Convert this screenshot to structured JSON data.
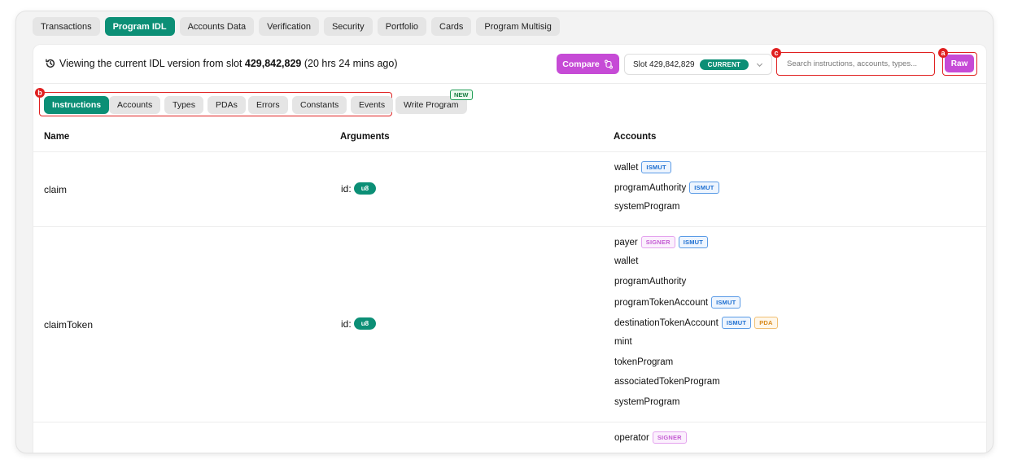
{
  "top_tabs": [
    "Transactions",
    "Program IDL",
    "Accounts Data",
    "Verification",
    "Security",
    "Portfolio",
    "Cards",
    "Program Multisig"
  ],
  "active_top_tab": "Program IDL",
  "header": {
    "viewing_prefix": "Viewing the current IDL version from slot ",
    "slot": "429,842,829",
    "viewing_suffix": " (20 hrs 24 mins ago)",
    "compare_label": "Compare",
    "slot_select_label": "Slot 429,842,829",
    "current_badge": "CURRENT",
    "search_placeholder": "Search instructions, accounts, types...",
    "raw_label": "Raw"
  },
  "markers": {
    "a": "a",
    "b": "b",
    "c": "c"
  },
  "sub_tabs": [
    "Instructions",
    "Accounts",
    "Types",
    "PDAs",
    "Errors",
    "Constants",
    "Events",
    "Write Program"
  ],
  "active_sub_tab": "Instructions",
  "new_badge": "NEW",
  "table": {
    "columns": [
      "Name",
      "Arguments",
      "Accounts"
    ],
    "rows": [
      {
        "name": "claim",
        "arg_name": "id:",
        "arg_type": "u8",
        "accounts": [
          {
            "name": "wallet",
            "badges": [
              "ISMUT"
            ]
          },
          {
            "name": "programAuthority",
            "badges": [
              "ISMUT"
            ]
          },
          {
            "name": "systemProgram",
            "badges": []
          }
        ]
      },
      {
        "name": "claimToken",
        "arg_name": "id:",
        "arg_type": "u8",
        "accounts": [
          {
            "name": "payer",
            "badges": [
              "SIGNER",
              "ISMUT"
            ]
          },
          {
            "name": "wallet",
            "badges": []
          },
          {
            "name": "programAuthority",
            "badges": []
          },
          {
            "name": "programTokenAccount",
            "badges": [
              "ISMUT"
            ]
          },
          {
            "name": "destinationTokenAccount",
            "badges": [
              "ISMUT",
              "PDA"
            ]
          },
          {
            "name": "mint",
            "badges": []
          },
          {
            "name": "tokenProgram",
            "badges": []
          },
          {
            "name": "associatedTokenProgram",
            "badges": []
          },
          {
            "name": "systemProgram",
            "badges": []
          }
        ]
      },
      {
        "name": "",
        "arg_name": "",
        "arg_type": "",
        "accounts": [
          {
            "name": "operator",
            "badges": [
              "SIGNER"
            ]
          }
        ]
      }
    ]
  },
  "colors": {
    "accent_green": "#0c8f76",
    "accent_purple": "#c64bd6",
    "highlight_red": "#e02020"
  }
}
